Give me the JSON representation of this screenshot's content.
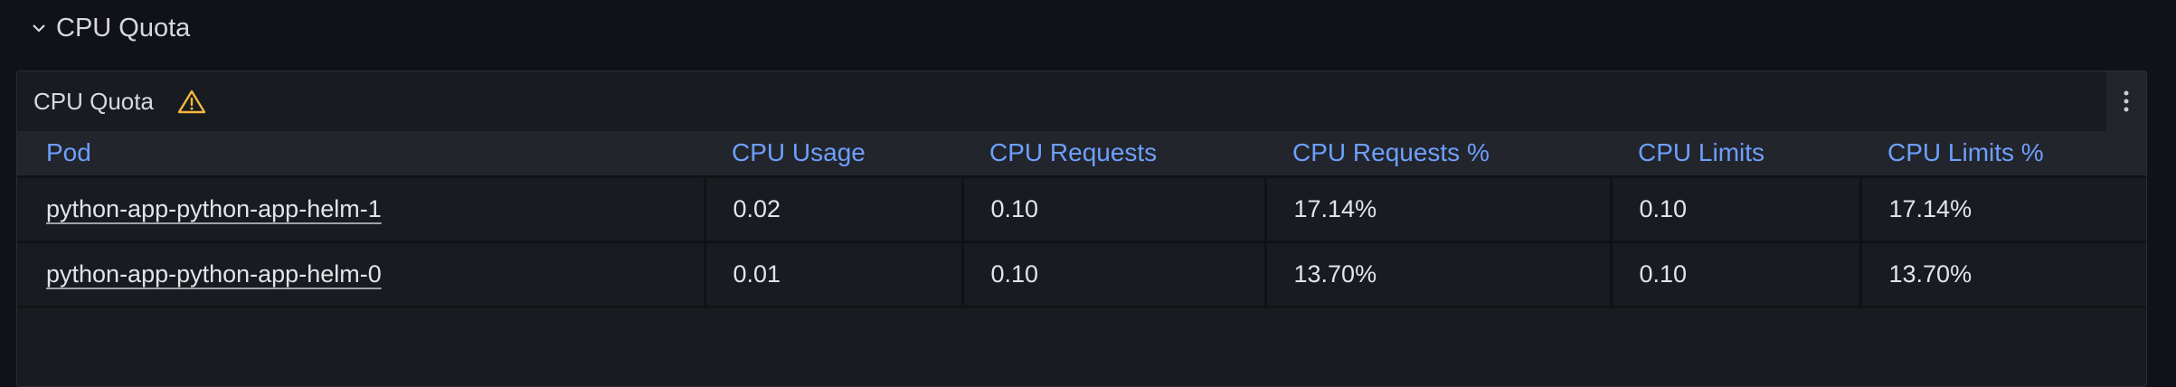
{
  "row": {
    "title": "CPU Quota"
  },
  "panel": {
    "title": "CPU Quota",
    "warning_icon": "warning-triangle-icon",
    "menu_icon": "kebab-menu-icon"
  },
  "table": {
    "columns": [
      "Pod",
      "CPU Usage",
      "CPU Requests",
      "CPU Requests %",
      "CPU Limits",
      "CPU Limits %"
    ],
    "rows": [
      [
        "python-app-python-app-helm-1",
        "0.02",
        "0.10",
        "17.14%",
        "0.10",
        "17.14%"
      ],
      [
        "python-app-python-app-helm-0",
        "0.01",
        "0.10",
        "13.70%",
        "0.10",
        "13.70%"
      ]
    ]
  },
  "colors": {
    "background": "#111217",
    "panel": "#181b1f",
    "header_text": "#6e9fff",
    "warning": "#f5b73d"
  }
}
